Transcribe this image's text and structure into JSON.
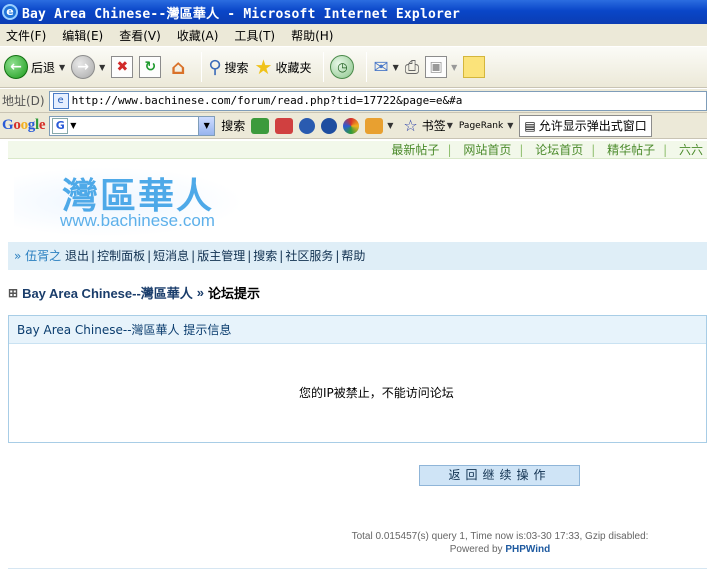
{
  "window": {
    "title": "Bay Area Chinese--灣區華人 - Microsoft Internet Explorer"
  },
  "menu": [
    "文件(F)",
    "编辑(E)",
    "查看(V)",
    "收藏(A)",
    "工具(T)",
    "帮助(H)"
  ],
  "toolbar": {
    "back_label": "后退",
    "search_label": "搜索",
    "favorites_label": "收藏夹"
  },
  "address": {
    "label": "地址(D)",
    "url": "http://www.bachinese.com/forum/read.php?tid=17722&page=e&#a"
  },
  "googlebar": {
    "logo": "Google",
    "search_button": "搜索",
    "bookmarks_label": "书签",
    "pagerank_label": "PageRank",
    "popup_label": "允许显示弹出式窗口"
  },
  "site": {
    "top_links": [
      "最新帖子",
      "网站首页",
      "论坛首页",
      "精华帖子",
      "六六"
    ],
    "logo_cn": "灣區華人",
    "logo_en": "www.bachinese.com",
    "nav": {
      "prefix": "»",
      "user": "伍胥之",
      "items": [
        "退出",
        "控制面板",
        "短消息",
        "版主管理",
        "搜索",
        "社区服务",
        "帮助"
      ]
    },
    "breadcrumb": {
      "forum": "Bay Area Chinese--灣區華人",
      "sep": "»",
      "current": "论坛提示"
    },
    "message": {
      "header": "Bay Area Chinese--灣區華人 提示信息",
      "text": "您的IP被禁止，不能访问论坛"
    },
    "return_button": "返回继续操作",
    "footer": {
      "line1": "Total 0.015457(s) query 1, Time now is:03-30 17:33, Gzip disabled:",
      "powered_prefix": "Powered by",
      "powered_name": "PHPWind"
    }
  }
}
